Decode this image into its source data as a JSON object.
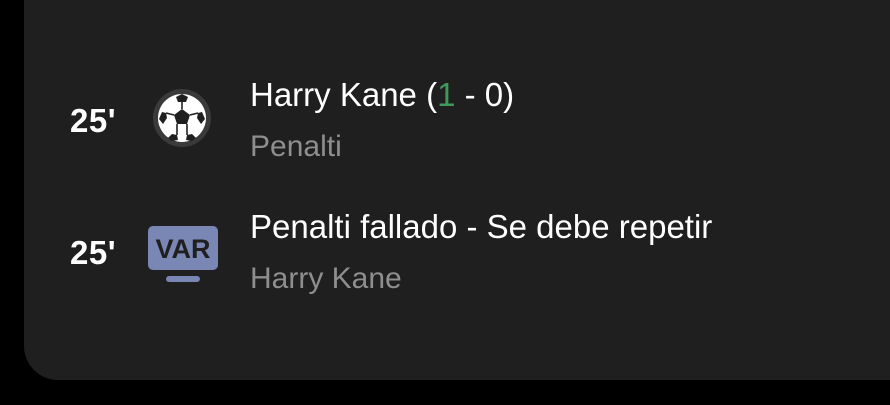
{
  "events": [
    {
      "minute": "25'",
      "icon": "soccer-ball-icon",
      "player": "Harry Kane",
      "score_open": " (",
      "score_home": "1",
      "score_rest": " - 0)",
      "detail": "Penalti"
    },
    {
      "minute": "25'",
      "icon": "var-icon",
      "icon_text": "VAR",
      "title": "Penalti fallado - Se debe repetir",
      "detail": "Harry Kane"
    }
  ],
  "colors": {
    "background": "#000000",
    "card": "#1f1f1f",
    "primary_text": "#ffffff",
    "secondary_text": "#8e8e8e",
    "score_highlight": "#3f9a5a",
    "var_badge": "#7a86b3"
  }
}
